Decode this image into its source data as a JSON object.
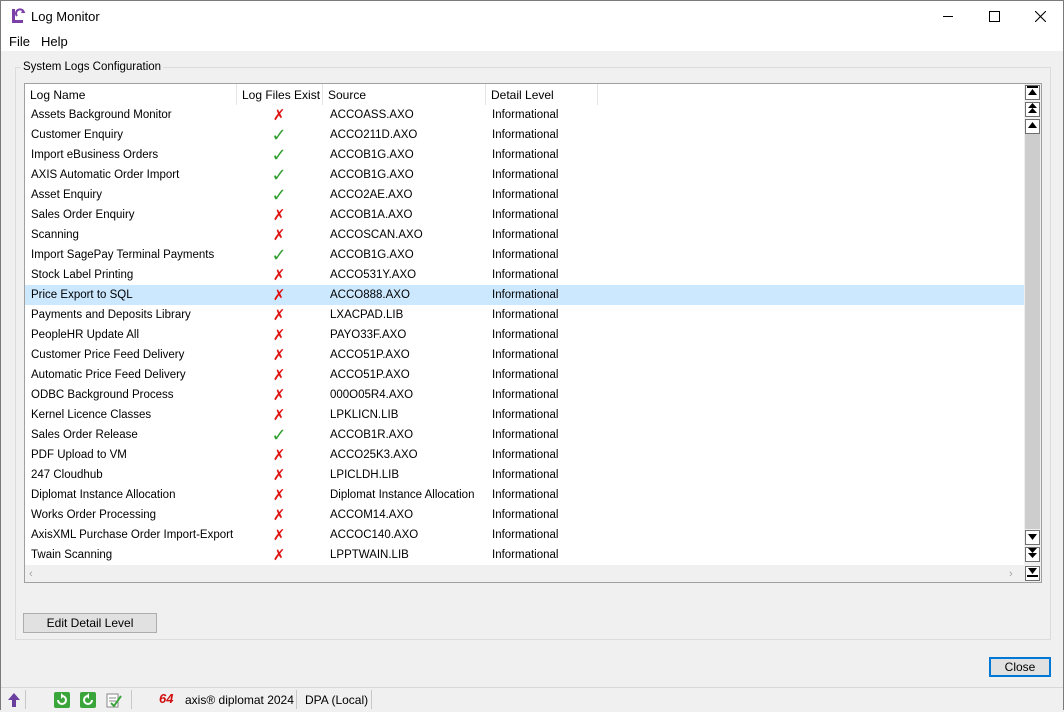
{
  "window": {
    "title": "Log Monitor",
    "minimize_glyph": "minimize-icon",
    "maximize_glyph": "maximize-icon",
    "close_glyph": "close-icon"
  },
  "menu": {
    "items": [
      "File",
      "Help"
    ]
  },
  "group": {
    "title": "System Logs Configuration"
  },
  "table": {
    "columns": [
      "Log Name",
      "Log Files Exist",
      "Source",
      "Detail Level"
    ],
    "selected_index": 9,
    "rows": [
      {
        "name": "Assets Background Monitor",
        "exists": false,
        "source": "ACCOASS.AXO",
        "level": "Informational"
      },
      {
        "name": "Customer Enquiry",
        "exists": true,
        "source": "ACCO211D.AXO",
        "level": "Informational"
      },
      {
        "name": "Import eBusiness Orders",
        "exists": true,
        "source": "ACCOB1G.AXO",
        "level": "Informational"
      },
      {
        "name": "AXIS Automatic Order Import",
        "exists": true,
        "source": "ACCOB1G.AXO",
        "level": "Informational"
      },
      {
        "name": "Asset Enquiry",
        "exists": true,
        "source": "ACCO2AE.AXO",
        "level": "Informational"
      },
      {
        "name": "Sales Order Enquiry",
        "exists": false,
        "source": "ACCOB1A.AXO",
        "level": "Informational"
      },
      {
        "name": "Scanning",
        "exists": false,
        "source": "ACCOSCAN.AXO",
        "level": "Informational"
      },
      {
        "name": "Import SagePay Terminal Payments",
        "exists": true,
        "source": "ACCOB1G.AXO",
        "level": "Informational"
      },
      {
        "name": "Stock Label Printing",
        "exists": false,
        "source": "ACCO531Y.AXO",
        "level": "Informational"
      },
      {
        "name": "Price Export to SQL",
        "exists": false,
        "source": "ACCO888.AXO",
        "level": "Informational"
      },
      {
        "name": "Payments and Deposits Library",
        "exists": false,
        "source": "LXACPAD.LIB",
        "level": "Informational"
      },
      {
        "name": "PeopleHR Update All",
        "exists": false,
        "source": "PAYO33F.AXO",
        "level": "Informational"
      },
      {
        "name": "Customer Price Feed Delivery",
        "exists": false,
        "source": "ACCO51P.AXO",
        "level": "Informational"
      },
      {
        "name": "Automatic Price Feed Delivery",
        "exists": false,
        "source": "ACCO51P.AXO",
        "level": "Informational"
      },
      {
        "name": "ODBC Background Process",
        "exists": false,
        "source": "000O05R4.AXO",
        "level": "Informational"
      },
      {
        "name": "Kernel Licence Classes",
        "exists": false,
        "source": "LPKLICN.LIB",
        "level": "Informational"
      },
      {
        "name": "Sales Order Release",
        "exists": true,
        "source": "ACCOB1R.AXO",
        "level": "Informational"
      },
      {
        "name": "PDF Upload to VM",
        "exists": false,
        "source": "ACCO25K3.AXO",
        "level": "Informational"
      },
      {
        "name": "247 Cloudhub",
        "exists": false,
        "source": "LPICLDH.LIB",
        "level": "Informational"
      },
      {
        "name": "Diplomat Instance Allocation",
        "exists": false,
        "source": "Diplomat Instance Allocation",
        "level": "Informational"
      },
      {
        "name": "Works Order Processing",
        "exists": false,
        "source": "ACCOM14.AXO",
        "level": "Informational"
      },
      {
        "name": "AxisXML Purchase Order Import-Export",
        "exists": false,
        "source": "ACCOC140.AXO",
        "level": "Informational"
      },
      {
        "name": "Twain Scanning",
        "exists": false,
        "source": "LPPTWAIN.LIB",
        "level": "Informational"
      }
    ],
    "check_glyph": "✓",
    "cross_glyph": "✗"
  },
  "buttons": {
    "edit_detail_level": "Edit Detail Level",
    "close": "Close"
  },
  "status": {
    "badge": "64",
    "product": "axis® diplomat 2024",
    "connection": "DPA (Local)"
  },
  "colors": {
    "selected_row": "#cce8ff",
    "check": "#2e9e2e",
    "cross": "#e01010",
    "default_button_border": "#0078d7"
  }
}
